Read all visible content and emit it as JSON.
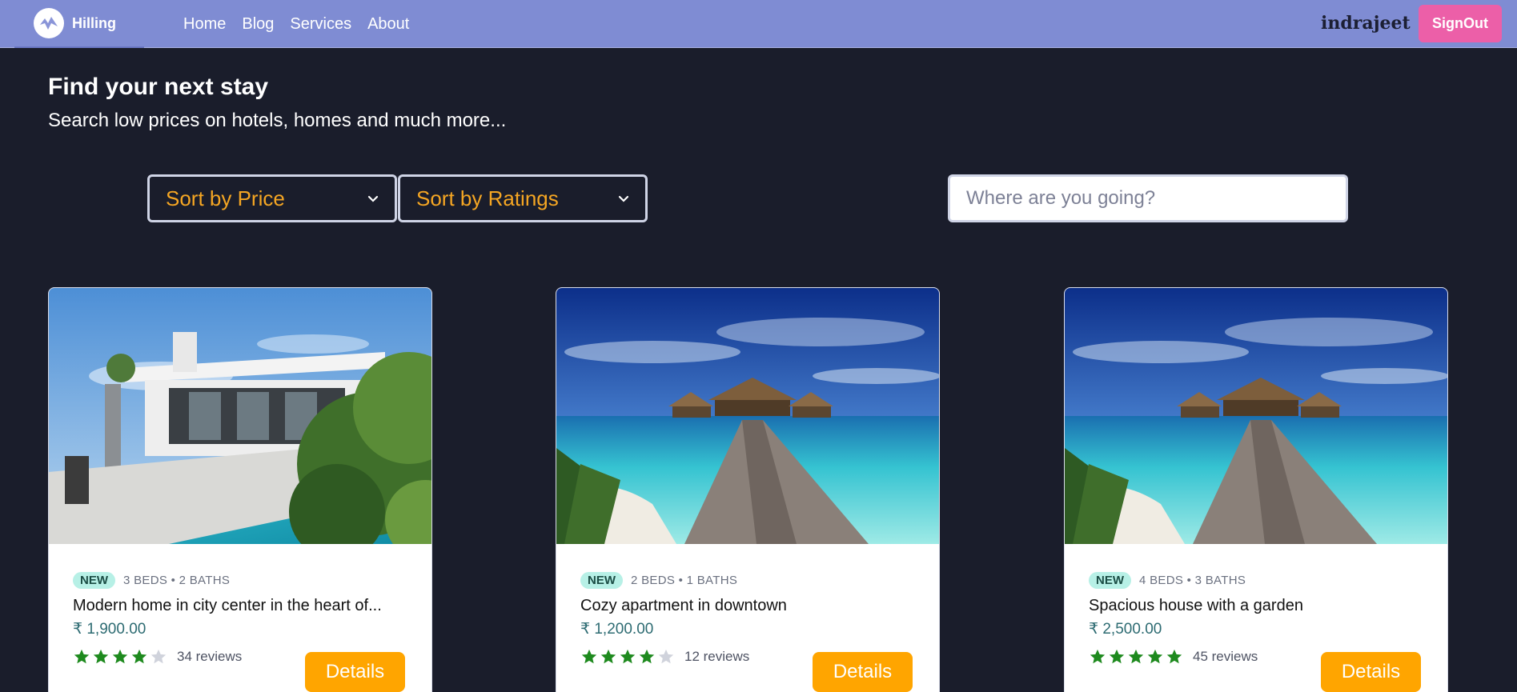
{
  "nav": {
    "brand_name": "Hilling",
    "links": [
      "Home",
      "Blog",
      "Services",
      "About"
    ],
    "username": "indrajeet",
    "signout_label": "SignOut"
  },
  "hero": {
    "title": "Find your next stay",
    "subtitle": "Search low prices on hotels, homes and much more..."
  },
  "filters": {
    "sort_price_label": "Sort by Price",
    "sort_ratings_label": "Sort by Ratings",
    "search_placeholder": "Where are you going?"
  },
  "listings": [
    {
      "badge": "NEW",
      "meta": "3 BEDS • 2 BATHS",
      "title": "Modern home in city center in the heart of...",
      "price": "₹ 1,900.00",
      "rating": 4,
      "reviews": "34 reviews",
      "button": "Details"
    },
    {
      "badge": "NEW",
      "meta": "2 BEDS • 1 BATHS",
      "title": "Cozy apartment in downtown",
      "price": "₹ 1,200.00",
      "rating": 4,
      "reviews": "12 reviews",
      "button": "Details"
    },
    {
      "badge": "NEW",
      "meta": "4 BEDS • 3 BATHS",
      "title": "Spacious house with a garden",
      "price": "₹ 2,500.00",
      "rating": 5,
      "reviews": "45 reviews",
      "button": "Details"
    }
  ],
  "colors": {
    "navbar": "#7f8cd3",
    "background": "#1a1d2b",
    "accent_orange": "#ffa500",
    "signout_pink": "#ec5fa8",
    "star_filled": "#1e8a1e",
    "star_empty": "#d0d3dc"
  }
}
